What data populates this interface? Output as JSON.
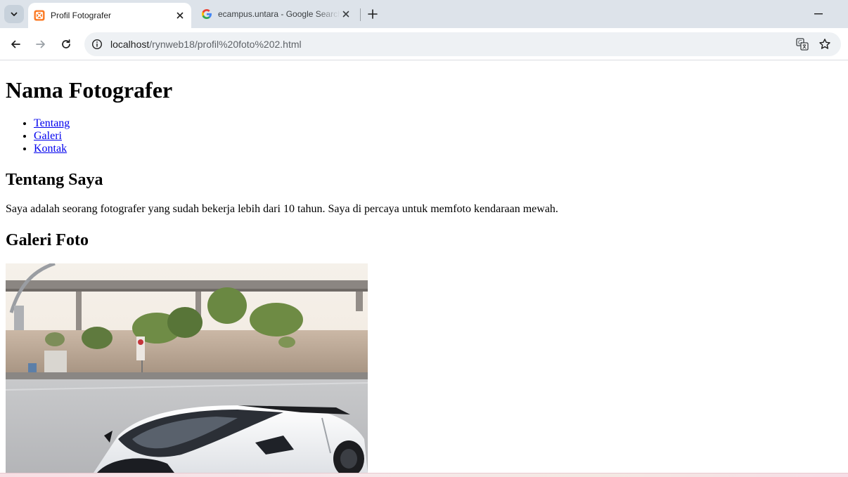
{
  "browser": {
    "tabs": [
      {
        "title": "Profil Fotografer",
        "active": true,
        "favicon": "xampp-icon"
      },
      {
        "title": "ecampus.untara - Google Search",
        "active": false,
        "favicon": "google-icon"
      }
    ],
    "url_host": "localhost",
    "url_path": "/rynweb18/profil%20foto%202.html"
  },
  "page": {
    "title": "Nama Fotografer",
    "nav": [
      "Tentang",
      "Galeri",
      "Kontak"
    ],
    "about_heading": "Tentang Saya",
    "about_text": "Saya adalah seorang fotografer yang sudah bekerja lebih dari 10 tahun. Saya di percaya untuk memfoto kendaraan mewah.",
    "gallery_heading": "Galeri Foto"
  },
  "colors": {
    "tabstrip": "#dde3ea",
    "link": "#0000ee",
    "car_body": "#f2f3f5",
    "sky": "#f4eee6"
  }
}
